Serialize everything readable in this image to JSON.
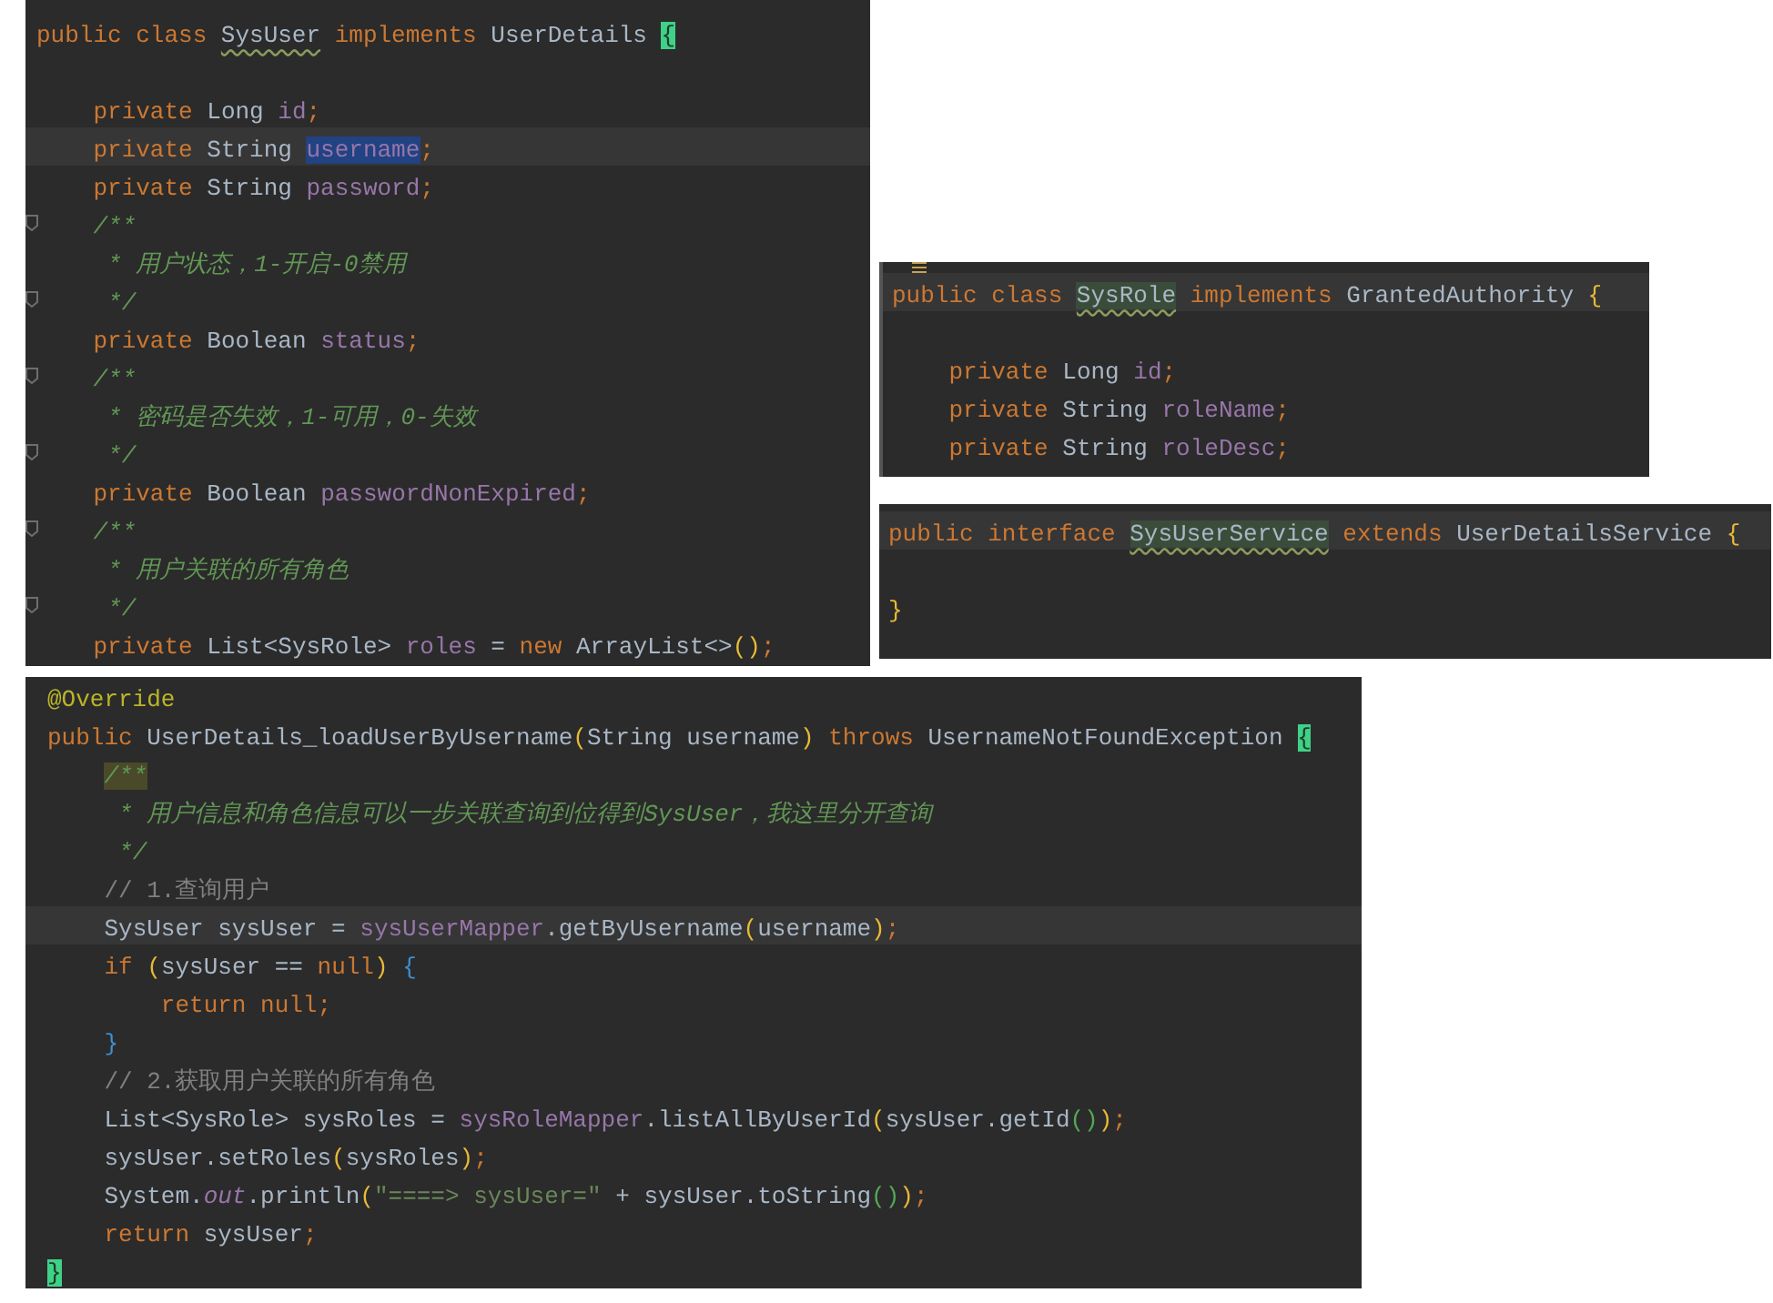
{
  "panels": [
    {
      "lines": [
        {
          "current": false,
          "fold": false,
          "tokens": [
            {
              "text": "public class ",
              "kind": "kw"
            },
            {
              "text": "SysUser",
              "kind": "plain",
              "warning": true
            },
            {
              "text": " implements ",
              "kind": "kw"
            },
            {
              "text": "UserDetails ",
              "kind": "plain"
            },
            {
              "text": "{",
              "kind": "plain",
              "matched": true
            }
          ]
        },
        {
          "current": false,
          "fold": false
        },
        {
          "current": false,
          "fold": false,
          "tokens": [
            {
              "text": "    private ",
              "kind": "kw"
            },
            {
              "text": "Long ",
              "kind": "plain"
            },
            {
              "text": "id",
              "kind": "field"
            },
            {
              "text": ";",
              "kind": "kw"
            }
          ]
        },
        {
          "current": true,
          "fold": false,
          "tokens": [
            {
              "text": "    private ",
              "kind": "kw"
            },
            {
              "text": "String ",
              "kind": "plain"
            },
            {
              "text": "username",
              "kind": "field",
              "selected": true
            },
            {
              "text": ";",
              "kind": "kw"
            }
          ]
        },
        {
          "current": false,
          "fold": false,
          "tokens": [
            {
              "text": "    private ",
              "kind": "kw"
            },
            {
              "text": "String ",
              "kind": "plain"
            },
            {
              "text": "password",
              "kind": "field"
            },
            {
              "text": ";",
              "kind": "kw"
            }
          ]
        },
        {
          "current": false,
          "fold": true,
          "tokens": [
            {
              "text": "    /**",
              "kind": "comment"
            }
          ]
        },
        {
          "current": false,
          "fold": false,
          "tokens": [
            {
              "text": "     * 用户状态，1-开启-0禁用",
              "kind": "comment"
            }
          ]
        },
        {
          "current": false,
          "fold": true,
          "tokens": [
            {
              "text": "     */",
              "kind": "comment"
            }
          ]
        },
        {
          "current": false,
          "fold": false,
          "tokens": [
            {
              "text": "    private ",
              "kind": "kw"
            },
            {
              "text": "Boolean ",
              "kind": "plain"
            },
            {
              "text": "status",
              "kind": "field"
            },
            {
              "text": ";",
              "kind": "kw"
            }
          ]
        },
        {
          "current": false,
          "fold": true,
          "tokens": [
            {
              "text": "    /**",
              "kind": "comment"
            }
          ]
        },
        {
          "current": false,
          "fold": false,
          "tokens": [
            {
              "text": "     * 密码是否失效，1-可用，0-失效",
              "kind": "comment"
            }
          ]
        },
        {
          "current": false,
          "fold": true,
          "tokens": [
            {
              "text": "     */",
              "kind": "comment"
            }
          ]
        },
        {
          "current": false,
          "fold": false,
          "tokens": [
            {
              "text": "    private ",
              "kind": "kw"
            },
            {
              "text": "Boolean ",
              "kind": "plain"
            },
            {
              "text": "passwordNonExpired",
              "kind": "field"
            },
            {
              "text": ";",
              "kind": "kw"
            }
          ]
        },
        {
          "current": false,
          "fold": true,
          "tokens": [
            {
              "text": "    /**",
              "kind": "comment"
            }
          ]
        },
        {
          "current": false,
          "fold": false,
          "tokens": [
            {
              "text": "     * 用户关联的所有角色",
              "kind": "comment"
            }
          ]
        },
        {
          "current": false,
          "fold": true,
          "tokens": [
            {
              "text": "     */",
              "kind": "comment"
            }
          ]
        },
        {
          "current": false,
          "fold": false,
          "tokens": [
            {
              "text": "    private ",
              "kind": "kw"
            },
            {
              "text": "List<SysRole> ",
              "kind": "plain"
            },
            {
              "text": "roles ",
              "kind": "field"
            },
            {
              "text": "= ",
              "kind": "plain"
            },
            {
              "text": "new ",
              "kind": "kw"
            },
            {
              "text": "ArrayList<>",
              "kind": "plain"
            },
            {
              "text": "()",
              "kind": "paren"
            },
            {
              "text": ";",
              "kind": "kw"
            }
          ]
        }
      ]
    },
    {
      "lines": [
        {
          "current": true,
          "fold": false,
          "tokens": [
            {
              "text": "public class ",
              "kind": "kw"
            },
            {
              "text": "SysRole",
              "kind": "plain",
              "warning": true,
              "highlighted": true
            },
            {
              "text": " implements ",
              "kind": "kw"
            },
            {
              "text": "GrantedAuthority ",
              "kind": "plain"
            },
            {
              "text": "{",
              "kind": "paren"
            }
          ]
        },
        {
          "current": false,
          "fold": false
        },
        {
          "current": false,
          "fold": false,
          "tokens": [
            {
              "text": "    private ",
              "kind": "kw"
            },
            {
              "text": "Long ",
              "kind": "plain"
            },
            {
              "text": "id",
              "kind": "field"
            },
            {
              "text": ";",
              "kind": "kw"
            }
          ]
        },
        {
          "current": false,
          "fold": false,
          "tokens": [
            {
              "text": "    private ",
              "kind": "kw"
            },
            {
              "text": "String ",
              "kind": "plain"
            },
            {
              "text": "roleName",
              "kind": "field"
            },
            {
              "text": ";",
              "kind": "kw"
            }
          ]
        },
        {
          "current": false,
          "fold": false,
          "tokens": [
            {
              "text": "    private ",
              "kind": "kw"
            },
            {
              "text": "String ",
              "kind": "plain"
            },
            {
              "text": "roleDesc",
              "kind": "field"
            },
            {
              "text": ";",
              "kind": "kw"
            }
          ]
        }
      ]
    },
    {
      "lines": [
        {
          "current": true,
          "fold": false,
          "tokens": [
            {
              "text": "public interface ",
              "kind": "kw"
            },
            {
              "text": "SysUserService",
              "kind": "plain",
              "warning": true,
              "highlighted": true
            },
            {
              "text": " extends ",
              "kind": "kw"
            },
            {
              "text": "UserDetailsService ",
              "kind": "plain"
            },
            {
              "text": "{",
              "kind": "paren"
            }
          ]
        },
        {
          "current": false,
          "fold": false
        },
        {
          "current": false,
          "fold": false,
          "tokens": [
            {
              "text": "}",
              "kind": "paren"
            }
          ]
        }
      ]
    },
    {
      "lines": [
        {
          "current": false,
          "fold": false,
          "tokens": [
            {
              "text": "@Override",
              "kind": "annotation"
            }
          ]
        },
        {
          "current": false,
          "fold": false,
          "tokens": [
            {
              "text": "public ",
              "kind": "kw"
            },
            {
              "text": "UserDetails_loadUserByUsername",
              "kind": "plain"
            },
            {
              "text": "(",
              "kind": "paren"
            },
            {
              "text": "String username",
              "kind": "plain"
            },
            {
              "text": ")",
              "kind": "paren"
            },
            {
              "text": " throws ",
              "kind": "kw"
            },
            {
              "text": "UsernameNotFoundException ",
              "kind": "plain"
            },
            {
              "text": "{",
              "kind": "plain",
              "matched": true
            }
          ]
        },
        {
          "current": false,
          "fold": false,
          "tokens": [
            {
              "text": "    /**",
              "kind": "comment",
              "highlighted": true
            }
          ]
        },
        {
          "current": false,
          "fold": false,
          "tokens": [
            {
              "text": "     * 用户信息和角色信息可以一步关联查询到位得到SysUser，我这里分开查询",
              "kind": "comment"
            }
          ]
        },
        {
          "current": false,
          "fold": false,
          "tokens": [
            {
              "text": "     */",
              "kind": "comment"
            }
          ]
        },
        {
          "current": false,
          "fold": false,
          "tokens": [
            {
              "text": "    // 1.查询用户",
              "kind": "line-comment"
            }
          ]
        },
        {
          "current": true,
          "fold": false,
          "tokens": [
            {
              "text": "    SysUser sysUser = ",
              "kind": "plain"
            },
            {
              "text": "sysUserMapper",
              "kind": "field"
            },
            {
              "text": ".getByUsername",
              "kind": "plain"
            },
            {
              "text": "(",
              "kind": "paren"
            },
            {
              "text": "username",
              "kind": "plain"
            },
            {
              "text": ")",
              "kind": "paren"
            },
            {
              "text": ";",
              "kind": "kw"
            }
          ]
        },
        {
          "current": false,
          "fold": false,
          "tokens": [
            {
              "text": "    if ",
              "kind": "kw"
            },
            {
              "text": "(",
              "kind": "paren"
            },
            {
              "text": "sysUser == ",
              "kind": "plain"
            },
            {
              "text": "null",
              "kind": "kw"
            },
            {
              "text": ")",
              "kind": "paren"
            },
            {
              "text": " {",
              "kind": "block"
            }
          ]
        },
        {
          "current": false,
          "fold": false,
          "tokens": [
            {
              "text": "        return null;",
              "kind": "kw"
            }
          ]
        },
        {
          "current": false,
          "fold": false,
          "tokens": [
            {
              "text": "    }",
              "kind": "block"
            }
          ]
        },
        {
          "current": false,
          "fold": false,
          "tokens": [
            {
              "text": "    // 2.获取用户关联的所有角色",
              "kind": "line-comment"
            }
          ]
        },
        {
          "current": false,
          "fold": false,
          "tokens": [
            {
              "text": "    List<SysRole> sysRoles = ",
              "kind": "plain"
            },
            {
              "text": "sysRoleMapper",
              "kind": "field"
            },
            {
              "text": ".listAllByUserId",
              "kind": "plain"
            },
            {
              "text": "(",
              "kind": "paren"
            },
            {
              "text": "sysUser.getId",
              "kind": "plain"
            },
            {
              "text": "()",
              "kind": "paren-inner"
            },
            {
              "text": ")",
              "kind": "paren"
            },
            {
              "text": ";",
              "kind": "kw"
            }
          ]
        },
        {
          "current": false,
          "fold": false,
          "tokens": [
            {
              "text": "    sysUser.setRoles",
              "kind": "plain"
            },
            {
              "text": "(",
              "kind": "paren"
            },
            {
              "text": "sysRoles",
              "kind": "plain"
            },
            {
              "text": ")",
              "kind": "paren"
            },
            {
              "text": ";",
              "kind": "kw"
            }
          ]
        },
        {
          "current": false,
          "fold": false,
          "tokens": [
            {
              "text": "    System.",
              "kind": "plain"
            },
            {
              "text": "out",
              "kind": "static"
            },
            {
              "text": ".println",
              "kind": "plain"
            },
            {
              "text": "(",
              "kind": "paren"
            },
            {
              "text": "\"====> sysUser=\"",
              "kind": "string"
            },
            {
              "text": " + sysUser.toString",
              "kind": "plain"
            },
            {
              "text": "()",
              "kind": "paren-inner"
            },
            {
              "text": ")",
              "kind": "paren"
            },
            {
              "text": ";",
              "kind": "kw"
            }
          ]
        },
        {
          "current": false,
          "fold": false,
          "tokens": [
            {
              "text": "    return ",
              "kind": "kw"
            },
            {
              "text": "sysUser",
              "kind": "plain"
            },
            {
              "text": ";",
              "kind": "kw"
            }
          ]
        },
        {
          "current": false,
          "fold": false,
          "tokens": [
            {
              "text": "}",
              "kind": "plain",
              "matched": true
            }
          ]
        }
      ]
    }
  ]
}
